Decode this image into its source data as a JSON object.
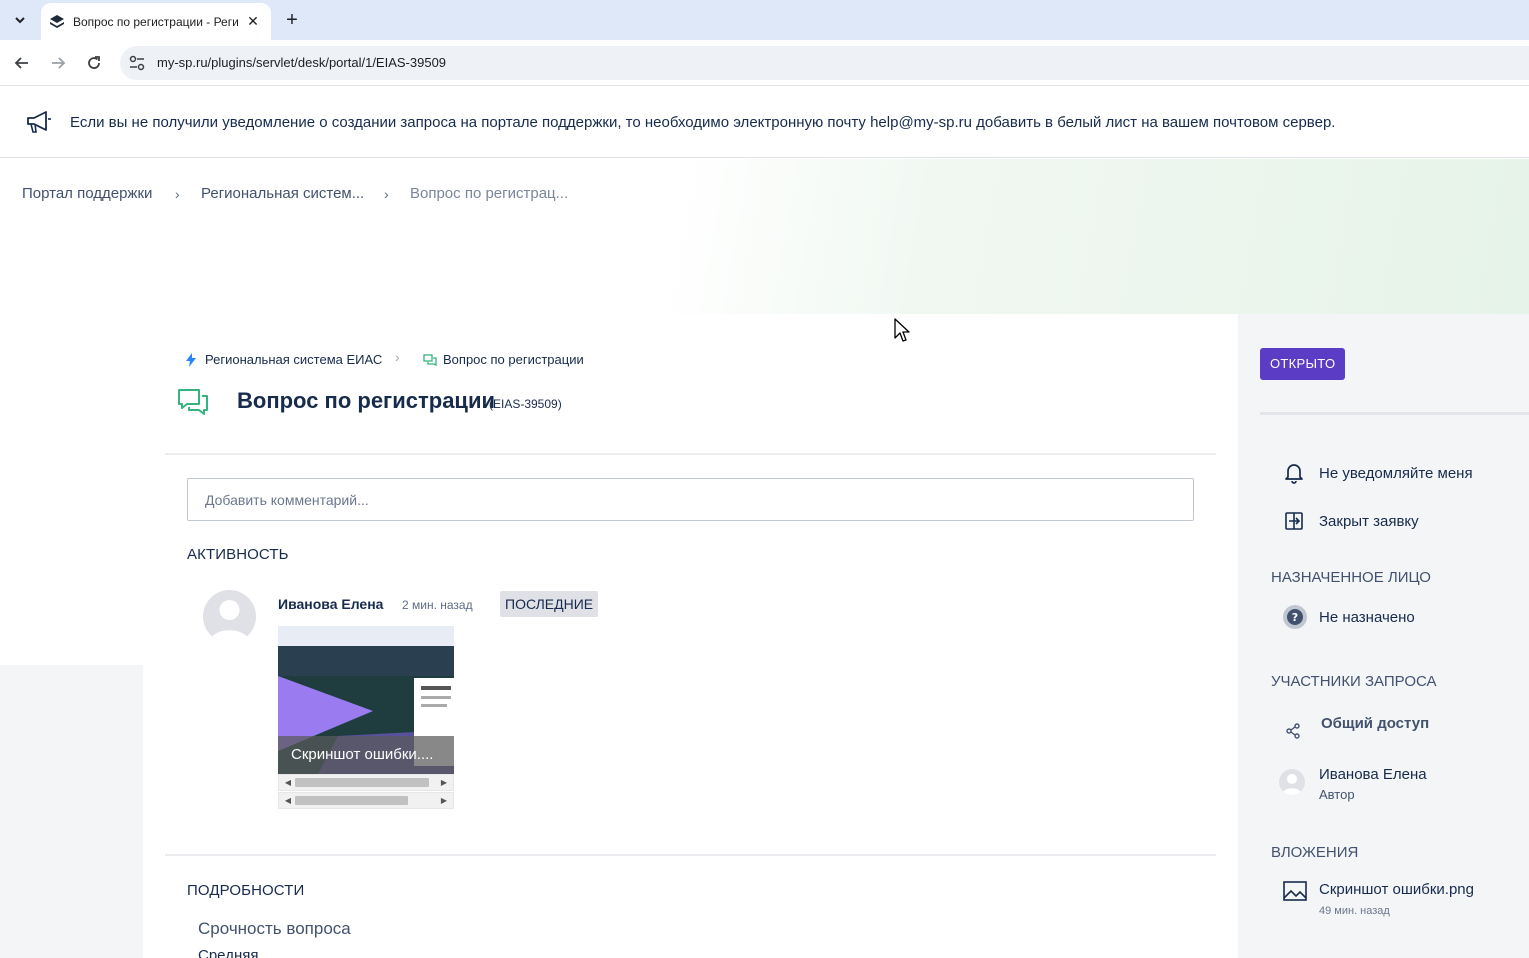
{
  "browser": {
    "tab_title": "Вопрос по регистрации - Реги",
    "url": "my-sp.ru/plugins/servlet/desk/portal/1/EIAS-39509"
  },
  "announcement": {
    "text": "Если вы не получили уведомление о создании запроса на портале поддержки, то необходимо электронную почту help@my-sp.ru добавить в белый лист на вашем почтовом сервер."
  },
  "breadcrumb": [
    "Портал поддержки",
    "Региональная систем...",
    "Вопрос по регистрац..."
  ],
  "request": {
    "project": "Региональная система ЕИАС",
    "type": "Вопрос по регистрации",
    "title": "Вопрос по регистрации",
    "key": "(EIAS-39509)"
  },
  "comment": {
    "placeholder": "Добавить комментарий..."
  },
  "activity": {
    "heading": "АКТИВНОСТЬ",
    "author": "Иванова Елена",
    "time": "2 мин. назад",
    "badge": "ПОСЛЕДНИЕ",
    "attachment_caption": "Скриншот ошибки...."
  },
  "details": {
    "heading": "ПОДРОБНОСТИ",
    "field_label": "Срочность вопроса",
    "field_value": "Средняя"
  },
  "sidebar": {
    "status": "ОТКРЫТО",
    "notify": "Не уведомляйте меня",
    "close": "Закрыт заявку",
    "assignee_heading": "НАЗНАЧЕННОЕ ЛИЦО",
    "assignee": "Не назначено",
    "participants_heading": "УЧАСТНИКИ ЗАПРОСА",
    "share": "Общий доступ",
    "participant_name": "Иванова Елена",
    "participant_role": "Автор",
    "attachments_heading": "ВЛОЖЕНИЯ",
    "attachment_name": "Скриншот ошибки.png",
    "attachment_time": "49 мин. назад"
  },
  "colors": {
    "status_button": "#5b3cc4",
    "tab_bar": "#dfe8f8",
    "sidebar_bg": "#f4f5f7",
    "icon_green": "#36b37e",
    "icon_blue": "#2684ff"
  }
}
